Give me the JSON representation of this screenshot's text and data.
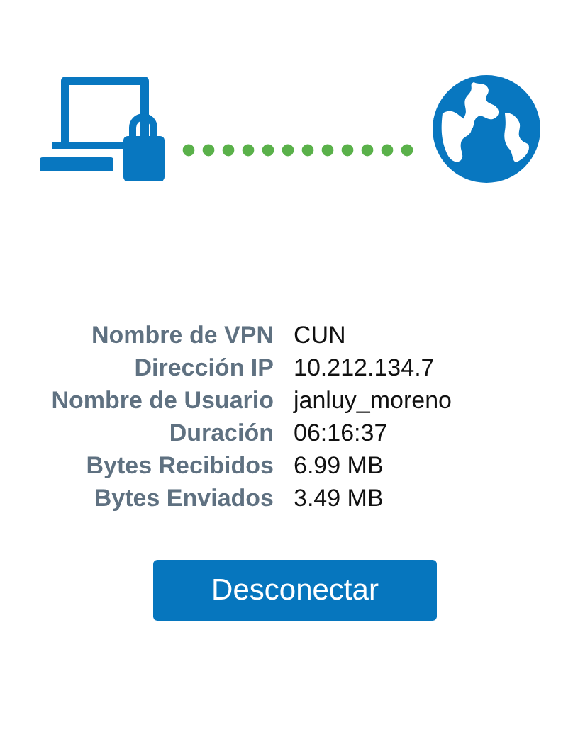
{
  "connection": {
    "connected": true
  },
  "details": [
    {
      "label": "Nombre de VPN",
      "value": "CUN"
    },
    {
      "label": "Dirección IP",
      "value": "10.212.134.7"
    },
    {
      "label": "Nombre de Usuario",
      "value": "janluy_moreno"
    },
    {
      "label": "Duración",
      "value": "06:16:37"
    },
    {
      "label": "Bytes Recibidos",
      "value": "6.99 MB"
    },
    {
      "label": "Bytes Enviados",
      "value": "3.49 MB"
    }
  ],
  "button": {
    "label": "Desconectar"
  }
}
